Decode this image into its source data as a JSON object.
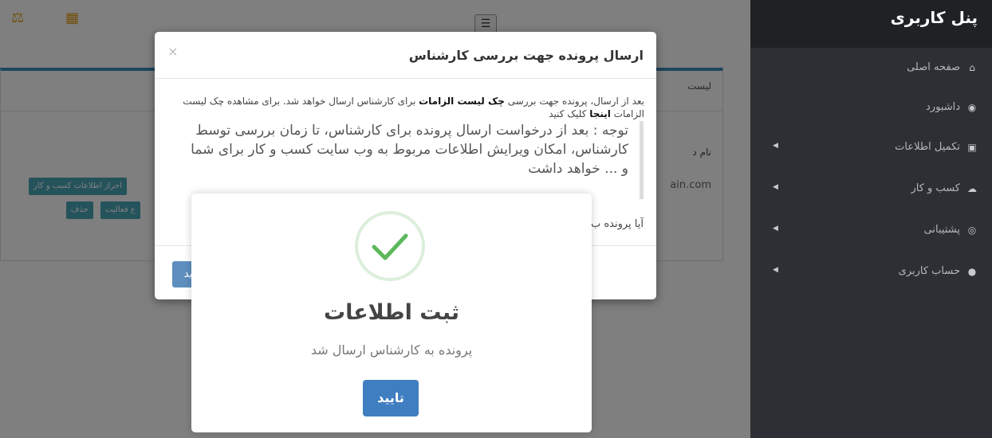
{
  "sidebar": {
    "title": "پنل کاربری",
    "items": [
      {
        "label": "صفحه اصلی",
        "icon": "home-icon",
        "glyph": "⌂",
        "arrow": ""
      },
      {
        "label": "داشبورد",
        "icon": "dashboard-icon",
        "glyph": "◉",
        "arrow": ""
      },
      {
        "label": "تکمیل اطلاعات",
        "icon": "id-card-icon",
        "glyph": "▣",
        "arrow": "◀"
      },
      {
        "label": "کسب و کار",
        "icon": "cloud-icon",
        "glyph": "☁",
        "arrow": "◀"
      },
      {
        "label": "پشتیبانی",
        "icon": "lifebuoy-icon",
        "glyph": "◎",
        "arrow": "◀"
      },
      {
        "label": "حساب کاربری",
        "icon": "user-icon",
        "glyph": "●",
        "arrow": "◀"
      }
    ]
  },
  "topbar": {
    "menu_glyph": "☰",
    "legal_glyph": "⚖",
    "calendar_glyph": "▦"
  },
  "background_panel": {
    "title_fragment": "لیست",
    "field_fragment": "نام د",
    "value_fragment": "ain.com",
    "buttons": [
      "احراز اطلاعات کسب و کار",
      "ع فعالیت",
      "حذف"
    ]
  },
  "modal": {
    "title": "ارسال پرونده جهت بررسی کارشناس",
    "close": "×",
    "text_part1": "بعد از ارسال، پرونده جهت بررسی ",
    "text_bold1": "چک لیست الزامات",
    "text_part2": " برای کارشناس ارسال خواهد شد. برای مشاهده چک لیست الزامات ",
    "text_bold2": "اینجا",
    "text_part3": " کلیک کنید",
    "note": "توجه : بعد از درخواست ارسال پرونده برای کارشناس، تا زمان بررسی توسط کارشناس، امکان ویرایش اطلاعات مربوط به وب سایت کسب و کار برای شما و ... خواهد داشت",
    "question": "آیا پرونده ب",
    "confirm_fragment": "ید"
  },
  "success": {
    "icon": "check-icon",
    "title": "ثبت اطلاعات",
    "text": "پرونده به کارشناس ارسال شد",
    "button": "تایید"
  },
  "colors": {
    "sidebar_bg": "#2c3035",
    "primary": "#3f7fc1",
    "success": "#5cb85c",
    "teal": "#4aa7b9"
  }
}
